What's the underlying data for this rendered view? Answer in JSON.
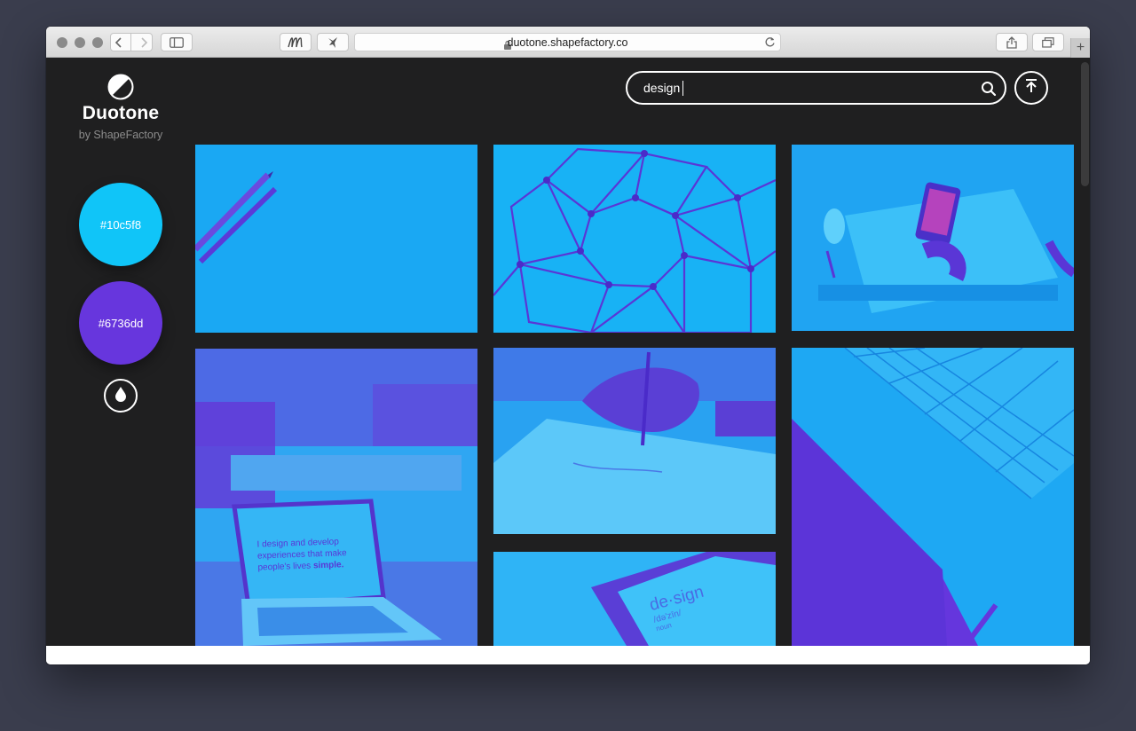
{
  "browser": {
    "url": "duotone.shapefactory.co",
    "icons": [
      "back-icon",
      "forward-icon",
      "sidebar-icon",
      "extension-m-icon",
      "extension-bird-icon",
      "lock-icon",
      "reload-icon",
      "share-icon",
      "tabs-icon",
      "new-tab-icon"
    ],
    "new_tab_label": "+"
  },
  "brand": {
    "title": "Duotone",
    "subtitle": "by ShapeFactory"
  },
  "colors": {
    "highlight": "#10c5f8",
    "shadow": "#6736dd",
    "highlight_label": "#10c5f8",
    "shadow_label": "#6736dd"
  },
  "search": {
    "value": "design",
    "placeholder": ""
  },
  "images": [
    {
      "subject": "pencils"
    },
    {
      "subject": "geodesic-structure"
    },
    {
      "subject": "desk-with-phone"
    },
    {
      "subject": "laptop-on-desk",
      "screen_text": [
        "I design and develop",
        "experiences that make",
        "people's lives",
        "simple."
      ]
    },
    {
      "subject": "hand-drawing"
    },
    {
      "subject": "tablet-keyboard"
    },
    {
      "subject": "phone-dictionary",
      "screen_text": [
        "de·sign",
        "/də'zīn/",
        "noun"
      ]
    }
  ]
}
